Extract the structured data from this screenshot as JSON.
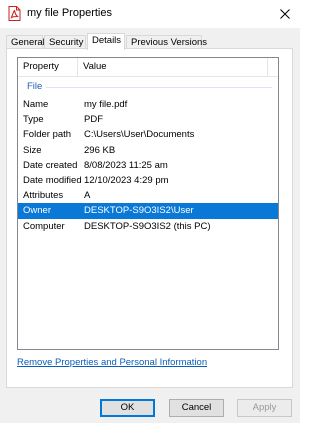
{
  "window": {
    "title": "my file Properties",
    "close_icon": "close-icon",
    "app_icon": "pdf-file-icon"
  },
  "tabs": [
    {
      "label": "General",
      "active": false
    },
    {
      "label": "Security",
      "active": false
    },
    {
      "label": "Details",
      "active": true
    },
    {
      "label": "Previous Versions",
      "active": false
    }
  ],
  "details": {
    "columns": {
      "property": "Property",
      "value": "Value"
    },
    "group": "File",
    "rows": [
      {
        "name": "Name",
        "value": "my file.pdf"
      },
      {
        "name": "Type",
        "value": "PDF"
      },
      {
        "name": "Folder path",
        "value": "C:\\Users\\User\\Documents"
      },
      {
        "name": "Size",
        "value": "296 KB"
      },
      {
        "name": "Date created",
        "value": "8/08/2023 11:25 am"
      },
      {
        "name": "Date modified",
        "value": "12/10/2023 4:29 pm"
      },
      {
        "name": "Attributes",
        "value": "A"
      },
      {
        "name": "Owner",
        "value": "DESKTOP-S9O3IS2\\User",
        "selected": true
      },
      {
        "name": "Computer",
        "value": "DESKTOP-S9O3IS2 (this PC)"
      }
    ]
  },
  "link": "Remove Properties and Personal Information",
  "buttons": {
    "ok": "OK",
    "cancel": "Cancel",
    "apply": "Apply"
  },
  "colors": {
    "selection": "#0a78d7",
    "link": "#0a5dbb",
    "group": "#1e5fb4"
  }
}
